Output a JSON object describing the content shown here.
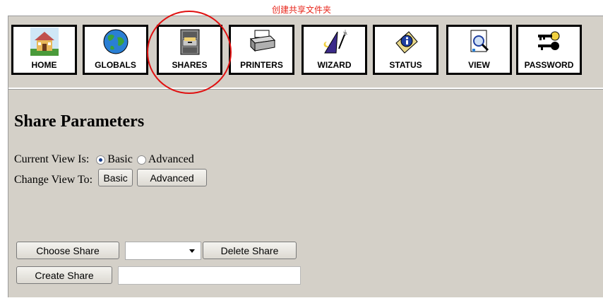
{
  "annotation": {
    "title": "创建共享文件夹",
    "highlight_color": "#e01010"
  },
  "nav": [
    {
      "label": "HOME",
      "icon": "house-icon"
    },
    {
      "label": "GLOBALS",
      "icon": "globe-icon"
    },
    {
      "label": "SHARES",
      "icon": "file-cabinet-icon"
    },
    {
      "label": "PRINTERS",
      "icon": "printer-icon"
    },
    {
      "label": "WIZARD",
      "icon": "wizard-hat-icon"
    },
    {
      "label": "STATUS",
      "icon": "info-icon"
    },
    {
      "label": "VIEW",
      "icon": "magnifier-document-icon"
    },
    {
      "label": "PASSWORD",
      "icon": "keys-icon"
    }
  ],
  "page": {
    "heading": "Share Parameters",
    "current_view_label": "Current View Is:",
    "view_options": [
      "Basic",
      "Advanced"
    ],
    "selected_view": "Basic",
    "change_view_label": "Change View To:",
    "change_buttons": [
      "Basic",
      "Advanced"
    ]
  },
  "shares": {
    "choose_button": "Choose Share",
    "select_value": "",
    "delete_button": "Delete Share",
    "create_button": "Create Share",
    "create_input_value": ""
  }
}
